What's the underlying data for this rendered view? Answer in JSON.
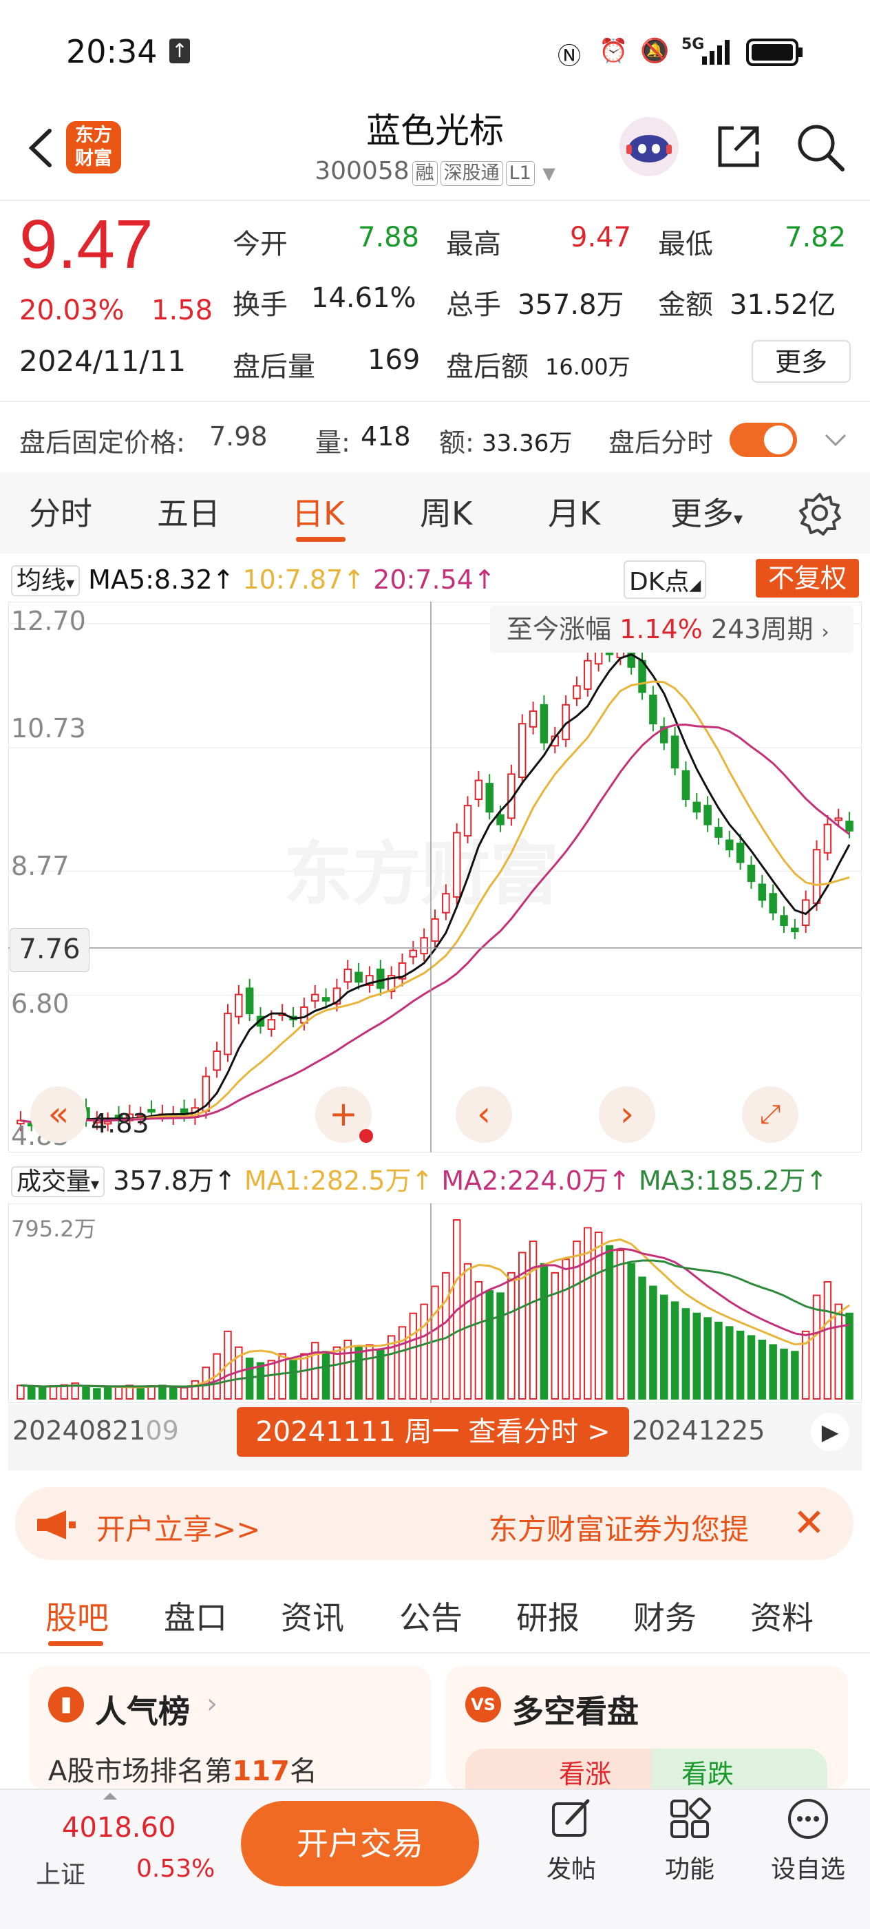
{
  "status_bar": {
    "time": "20:34",
    "network": "5G"
  },
  "header": {
    "logo_line1": "东方",
    "logo_line2": "财富",
    "stock_name": "蓝色光标",
    "stock_code": "300058",
    "tags": [
      "融",
      "深股通",
      "L1"
    ]
  },
  "quote": {
    "price": "9.47",
    "change_pct": "20.03%",
    "change": "1.58",
    "date": "2024/11/11",
    "fields": [
      {
        "label": "今开",
        "value": "7.88",
        "color": "green"
      },
      {
        "label": "最高",
        "value": "9.47",
        "color": "red"
      },
      {
        "label": "最低",
        "value": "7.82",
        "color": "green"
      },
      {
        "label": "换手",
        "value": "14.61%"
      },
      {
        "label": "总手",
        "value": "357.8万"
      },
      {
        "label": "金额",
        "value": "31.52亿"
      },
      {
        "label": "盘后量",
        "value": "169"
      },
      {
        "label": "盘后额",
        "value": "16.00万"
      }
    ],
    "more_label": "更多"
  },
  "after_hours": {
    "fixed_price_label": "盘后固定价格:",
    "fixed_price": "7.98",
    "volume_label": "量:",
    "volume": "418",
    "amount_label": "额:",
    "amount": "33.36万",
    "toggle_label": "盘后分时"
  },
  "tabs": [
    "分时",
    "五日",
    "日K",
    "周K",
    "月K",
    "更多"
  ],
  "active_tab": "日K",
  "ma_bar": {
    "type_label": "均线",
    "ma5": "MA5:8.32↑",
    "ma10": "10:7.87↑",
    "ma20": "20:7.54↑",
    "dk_label": "DK点",
    "restore_label": "不复权"
  },
  "kline": {
    "axis_labels": [
      "12.70",
      "10.73",
      "8.77",
      "6.80",
      "4.83"
    ],
    "crosshair_price": "7.76",
    "min_label": "4.83",
    "summary_label": "至今涨幅",
    "summary_value": "1.14%",
    "summary_period": "243周期",
    "watermark": "东方财富"
  },
  "volume_bar": {
    "type_label": "成交量",
    "value": "357.8万↑",
    "ma1": "MA1:282.5万↑",
    "ma2": "MA2:224.0万↑",
    "ma3": "MA3:185.2万↑",
    "max_label": "795.2万"
  },
  "date_bar": {
    "start": "20240821",
    "start_suffix": "09",
    "pill": "20241111 周一 查看分时 >",
    "end": "20241225"
  },
  "banner": {
    "left": "开户立享>>",
    "right": "东方财富证券为您提"
  },
  "bottom_tabs": [
    "股吧",
    "盘口",
    "资讯",
    "公告",
    "研报",
    "财务",
    "资料"
  ],
  "cards": {
    "popularity_title": "人气榜",
    "popularity_text_prefix": "A股市场排名第",
    "popularity_rank": "117",
    "popularity_text_suffix": "名",
    "longshort_title": "多空看盘",
    "bull_label": "看涨",
    "bear_label": "看跌"
  },
  "bottom_nav": {
    "index_value": "4018.60",
    "index_name": "上证",
    "index_pct": "0.53%",
    "trade_label": "开户交易",
    "post_label": "发帖",
    "function_label": "功能",
    "watchlist_label": "设自选"
  },
  "colors": {
    "accent": "#e8531a",
    "up": "#e0262c",
    "down": "#1a9a2c",
    "ma5": "#111111",
    "ma10": "#e8b53a",
    "ma20": "#c4307a"
  },
  "chart_data": {
    "type": "candlestick",
    "title": "",
    "ylim": [
      4.83,
      12.7
    ],
    "current_close": 9.47,
    "crosshair_date": "20241111",
    "crosshair_price": 7.76,
    "closes": [
      4.9,
      4.85,
      4.83,
      4.88,
      4.95,
      5.0,
      4.92,
      4.9,
      4.88,
      4.95,
      5.0,
      4.97,
      5.05,
      5.0,
      4.98,
      5.0,
      5.1,
      5.6,
      6.0,
      6.6,
      6.9,
      6.6,
      6.4,
      6.5,
      6.6,
      6.5,
      6.7,
      6.9,
      6.8,
      7.0,
      7.3,
      7.1,
      7.2,
      7.0,
      7.2,
      7.4,
      7.6,
      7.8,
      8.1,
      8.5,
      9.47,
      9.9,
      10.3,
      9.8,
      9.6,
      10.4,
      11.2,
      11.4,
      10.9,
      11.0,
      11.5,
      11.8,
      12.2,
      12.4,
      12.3,
      12.5,
      12.1,
      11.7,
      11.2,
      10.9,
      10.5,
      10.0,
      9.8,
      9.6,
      9.4,
      9.2,
      9.0,
      8.7,
      8.4,
      8.2,
      8.0,
      7.9,
      8.4,
      9.2,
      9.6,
      9.7,
      9.5
    ],
    "ma5_label": "MA5:8.32",
    "ma10_label": "10:7.87",
    "ma20_label": "20:7.54",
    "volumes": [
      60,
      55,
      50,
      58,
      62,
      70,
      50,
      45,
      48,
      55,
      60,
      52,
      58,
      60,
      48,
      50,
      80,
      140,
      200,
      300,
      230,
      180,
      160,
      170,
      200,
      170,
      200,
      250,
      210,
      230,
      260,
      230,
      240,
      220,
      280,
      320,
      380,
      420,
      500,
      560,
      795,
      600,
      520,
      480,
      470,
      560,
      650,
      700,
      600,
      560,
      620,
      700,
      760,
      740,
      680,
      660,
      600,
      540,
      500,
      460,
      430,
      400,
      380,
      360,
      340,
      320,
      300,
      280,
      260,
      240,
      220,
      210,
      300,
      460,
      520,
      420,
      380
    ],
    "volume_max_label": "795.2万"
  }
}
